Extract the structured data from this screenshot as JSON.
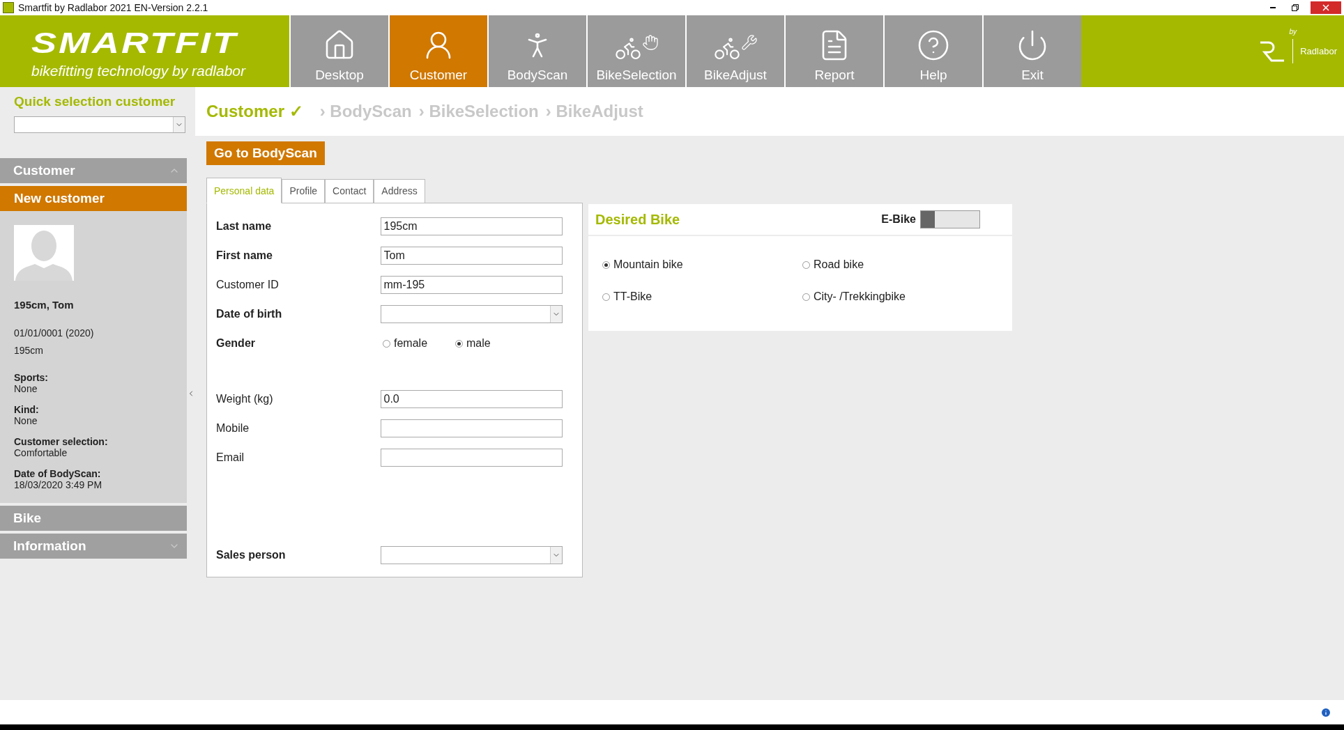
{
  "window": {
    "title": "Smartfit by Radlabor 2021 EN-Version 2.2.1"
  },
  "header": {
    "wordmark": "SMARTFIT",
    "tagline": "bikefitting technology by radlabor",
    "nav": [
      {
        "label": "Desktop",
        "kind": "home",
        "selected": false
      },
      {
        "label": "Customer",
        "kind": "customer",
        "selected": true
      },
      {
        "label": "BodyScan",
        "kind": "bodyscan",
        "selected": false
      },
      {
        "label": "BikeSelection",
        "kind": "bikeselect",
        "selected": false
      },
      {
        "label": "BikeAdjust",
        "kind": "bikeadjust",
        "selected": false
      },
      {
        "label": "Report",
        "kind": "report",
        "selected": false
      },
      {
        "label": "Help",
        "kind": "help",
        "selected": false
      },
      {
        "label": "Exit",
        "kind": "exit",
        "selected": false
      }
    ],
    "brand": {
      "by": "by",
      "name": "Radlabor"
    }
  },
  "sidebar": {
    "quick_selection": {
      "title": "Quick selection customer"
    },
    "sections": [
      {
        "title": "Customer",
        "expanded": true,
        "active_item": "New customer",
        "profile": {
          "name": "195cm, Tom",
          "lines": [
            "01/01/0001 (2020)",
            "195cm"
          ],
          "facts": [
            {
              "label": "Sports:",
              "value": "None"
            },
            {
              "label": "Kind:",
              "value": "None"
            },
            {
              "label": "Customer selection:",
              "value": "Comfortable"
            },
            {
              "label": "Date of BodyScan:",
              "value": "18/03/2020 3:49 PM"
            }
          ]
        }
      },
      {
        "title": "Bike"
      },
      {
        "title": "Information",
        "expanded": false
      }
    ]
  },
  "breadcrumb": [
    {
      "label": "Customer",
      "check": "✓",
      "selected": true
    },
    {
      "separator": "›",
      "label": "BodyScan",
      "selected": false
    },
    {
      "separator": "›",
      "label": "BikeSelection",
      "selected": false
    },
    {
      "separator": "›",
      "label": "BikeAdjust",
      "selected": false
    }
  ],
  "primary_button": "Go to BodyScan",
  "tabs": [
    {
      "label": "Personal data",
      "selected": true
    },
    {
      "label": "Profile",
      "selected": false
    },
    {
      "label": "Contact",
      "selected": false
    },
    {
      "label": "Address",
      "selected": false
    }
  ],
  "form": [
    {
      "label": "Last name",
      "required": true,
      "kind": "text",
      "value": "195cm"
    },
    {
      "label": "First name",
      "required": true,
      "kind": "text",
      "value": "Tom"
    },
    {
      "label": "Customer ID",
      "required": false,
      "kind": "text",
      "value": "mm-195"
    },
    {
      "label": "Date of birth",
      "required": true,
      "kind": "select"
    },
    {
      "label": "Gender",
      "required": true,
      "kind": "radio",
      "options": [
        {
          "label": "female",
          "selected": false
        },
        {
          "label": "male",
          "selected": true
        }
      ]
    },
    {
      "label": "Weight (kg)",
      "required": false,
      "kind": "text",
      "value": "0.0"
    },
    {
      "label": "Mobile",
      "required": false,
      "kind": "text"
    },
    {
      "label": "Email",
      "required": false,
      "kind": "text"
    },
    {
      "label": "Sales person",
      "required": true,
      "kind": "select"
    }
  ],
  "desired_bike": {
    "title": "Desired Bike",
    "ebike": {
      "label": "E-Bike",
      "on": false
    },
    "options": [
      {
        "label": "Mountain bike",
        "selected": true
      },
      {
        "label": "Road bike",
        "selected": false
      },
      {
        "label": "TT-Bike",
        "selected": false
      },
      {
        "label": "City- /Trekkingbike",
        "selected": false
      }
    ]
  }
}
